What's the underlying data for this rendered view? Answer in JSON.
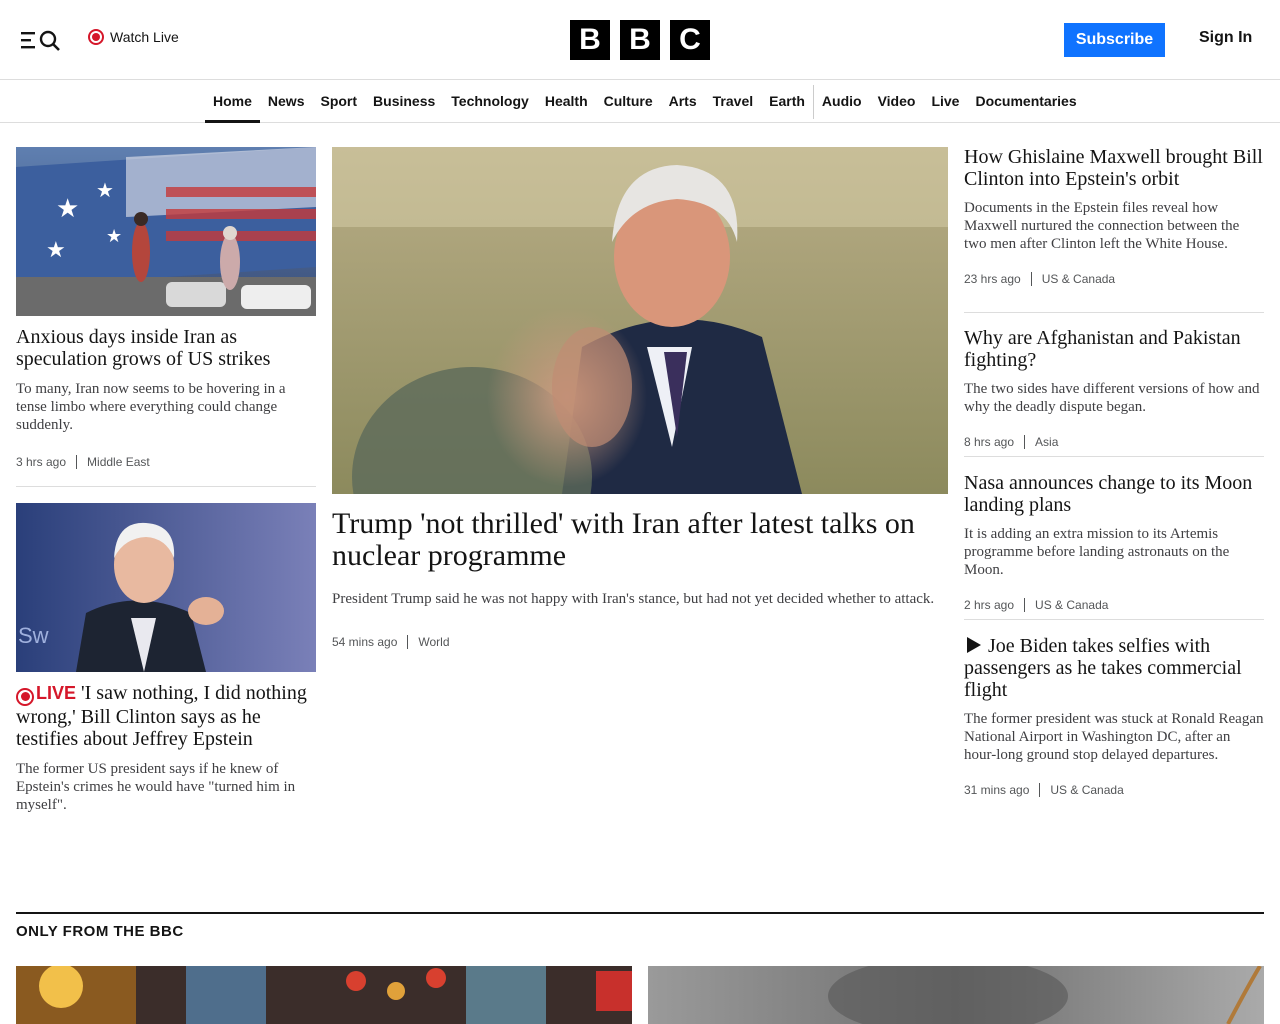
{
  "header": {
    "watch_live": "Watch Live",
    "logo_letters": [
      "B",
      "B",
      "C"
    ],
    "subscribe": "Subscribe",
    "sign_in": "Sign In"
  },
  "nav": {
    "items": [
      "Home",
      "News",
      "Sport",
      "Business",
      "Technology",
      "Health",
      "Culture",
      "Arts",
      "Travel",
      "Earth",
      "Audio",
      "Video",
      "Live",
      "Documentaries"
    ],
    "active": "Home"
  },
  "stories": {
    "left1": {
      "headline": "Anxious days inside Iran as speculation grows of US strikes",
      "summary": "To many, Iran now seems to be hovering in a tense limbo where everything could change suddenly.",
      "time": "3 hrs ago",
      "tag": "Middle East"
    },
    "left2": {
      "live_label": "LIVE",
      "headline": "'I saw nothing, I did nothing wrong,' Bill Clinton says as he testifies about Jeffrey Epstein",
      "summary": "The former US president says if he knew of Epstein's crimes he would have \"turned him in myself\"."
    },
    "main": {
      "headline": "Trump 'not thrilled' with Iran after latest talks on nuclear programme",
      "summary": "President Trump said he was not happy with Iran's stance, but had not yet decided whether to attack.",
      "time": "54 mins ago",
      "tag": "World"
    },
    "right1": {
      "headline": "How Ghislaine Maxwell brought Bill Clinton into Epstein's orbit",
      "summary": "Documents in the Epstein files reveal how Maxwell nurtured the connection between the two men after Clinton left the White House.",
      "time": "23 hrs ago",
      "tag": "US & Canada"
    },
    "right2": {
      "headline": "Why are Afghanistan and Pakistan fighting?",
      "summary": "The two sides have different versions of how and why the deadly dispute began.",
      "time": "8 hrs ago",
      "tag": "Asia"
    },
    "right3": {
      "headline": "Nasa announces change to its Moon landing plans",
      "summary": "It is adding an extra mission to its Artemis programme before landing astronauts on the Moon.",
      "time": "2 hrs ago",
      "tag": "US & Canada"
    },
    "right4": {
      "headline": "Joe Biden takes selfies with passengers as he takes commercial flight",
      "summary": "The former president was stuck at Ronald Reagan National Airport in Washington DC, after an hour-long ground stop delayed departures.",
      "time": "31 mins ago",
      "tag": "US & Canada"
    }
  },
  "section": {
    "title": "ONLY FROM THE BBC"
  },
  "colors": {
    "accent_blue": "#0f73ff",
    "live_red": "#d5172a",
    "text": "#141414"
  }
}
